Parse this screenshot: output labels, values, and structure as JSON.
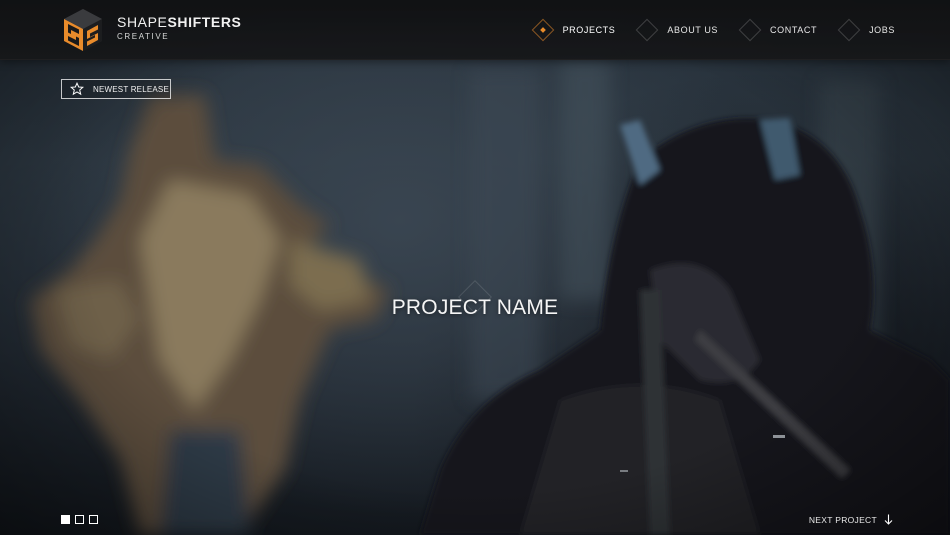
{
  "brand": {
    "name_light": "SHAPE",
    "name_bold": "SHIFTERS",
    "subtitle": "CREATIVE",
    "logo_icon": "shapeshifters-logo-icon",
    "accent_color": "#e88b2b"
  },
  "nav": {
    "items": [
      {
        "label": "PROJECTS",
        "active": true
      },
      {
        "label": "ABOUT US",
        "active": false
      },
      {
        "label": "CONTACT",
        "active": false
      },
      {
        "label": "JOBS",
        "active": false
      }
    ]
  },
  "badge": {
    "label": "NEWEST RELEASE",
    "icon": "star-icon"
  },
  "hero": {
    "project_title": "PROJECT NAME"
  },
  "pager": {
    "count": 3,
    "active_index": 0
  },
  "next": {
    "label": "NEXT PROJECT",
    "icon": "arrow-down-icon"
  }
}
